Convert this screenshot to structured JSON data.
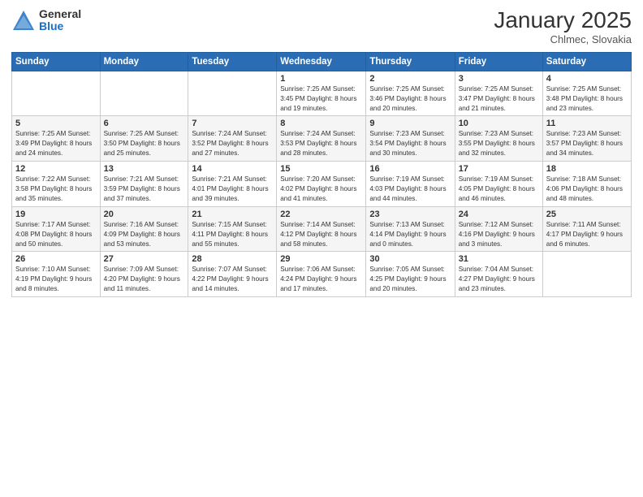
{
  "logo": {
    "general": "General",
    "blue": "Blue"
  },
  "header": {
    "month": "January 2025",
    "location": "Chlmec, Slovakia"
  },
  "weekdays": [
    "Sunday",
    "Monday",
    "Tuesday",
    "Wednesday",
    "Thursday",
    "Friday",
    "Saturday"
  ],
  "weeks": [
    [
      {
        "day": "",
        "info": ""
      },
      {
        "day": "",
        "info": ""
      },
      {
        "day": "",
        "info": ""
      },
      {
        "day": "1",
        "info": "Sunrise: 7:25 AM\nSunset: 3:45 PM\nDaylight: 8 hours\nand 19 minutes."
      },
      {
        "day": "2",
        "info": "Sunrise: 7:25 AM\nSunset: 3:46 PM\nDaylight: 8 hours\nand 20 minutes."
      },
      {
        "day": "3",
        "info": "Sunrise: 7:25 AM\nSunset: 3:47 PM\nDaylight: 8 hours\nand 21 minutes."
      },
      {
        "day": "4",
        "info": "Sunrise: 7:25 AM\nSunset: 3:48 PM\nDaylight: 8 hours\nand 23 minutes."
      }
    ],
    [
      {
        "day": "5",
        "info": "Sunrise: 7:25 AM\nSunset: 3:49 PM\nDaylight: 8 hours\nand 24 minutes."
      },
      {
        "day": "6",
        "info": "Sunrise: 7:25 AM\nSunset: 3:50 PM\nDaylight: 8 hours\nand 25 minutes."
      },
      {
        "day": "7",
        "info": "Sunrise: 7:24 AM\nSunset: 3:52 PM\nDaylight: 8 hours\nand 27 minutes."
      },
      {
        "day": "8",
        "info": "Sunrise: 7:24 AM\nSunset: 3:53 PM\nDaylight: 8 hours\nand 28 minutes."
      },
      {
        "day": "9",
        "info": "Sunrise: 7:23 AM\nSunset: 3:54 PM\nDaylight: 8 hours\nand 30 minutes."
      },
      {
        "day": "10",
        "info": "Sunrise: 7:23 AM\nSunset: 3:55 PM\nDaylight: 8 hours\nand 32 minutes."
      },
      {
        "day": "11",
        "info": "Sunrise: 7:23 AM\nSunset: 3:57 PM\nDaylight: 8 hours\nand 34 minutes."
      }
    ],
    [
      {
        "day": "12",
        "info": "Sunrise: 7:22 AM\nSunset: 3:58 PM\nDaylight: 8 hours\nand 35 minutes."
      },
      {
        "day": "13",
        "info": "Sunrise: 7:21 AM\nSunset: 3:59 PM\nDaylight: 8 hours\nand 37 minutes."
      },
      {
        "day": "14",
        "info": "Sunrise: 7:21 AM\nSunset: 4:01 PM\nDaylight: 8 hours\nand 39 minutes."
      },
      {
        "day": "15",
        "info": "Sunrise: 7:20 AM\nSunset: 4:02 PM\nDaylight: 8 hours\nand 41 minutes."
      },
      {
        "day": "16",
        "info": "Sunrise: 7:19 AM\nSunset: 4:03 PM\nDaylight: 8 hours\nand 44 minutes."
      },
      {
        "day": "17",
        "info": "Sunrise: 7:19 AM\nSunset: 4:05 PM\nDaylight: 8 hours\nand 46 minutes."
      },
      {
        "day": "18",
        "info": "Sunrise: 7:18 AM\nSunset: 4:06 PM\nDaylight: 8 hours\nand 48 minutes."
      }
    ],
    [
      {
        "day": "19",
        "info": "Sunrise: 7:17 AM\nSunset: 4:08 PM\nDaylight: 8 hours\nand 50 minutes."
      },
      {
        "day": "20",
        "info": "Sunrise: 7:16 AM\nSunset: 4:09 PM\nDaylight: 8 hours\nand 53 minutes."
      },
      {
        "day": "21",
        "info": "Sunrise: 7:15 AM\nSunset: 4:11 PM\nDaylight: 8 hours\nand 55 minutes."
      },
      {
        "day": "22",
        "info": "Sunrise: 7:14 AM\nSunset: 4:12 PM\nDaylight: 8 hours\nand 58 minutes."
      },
      {
        "day": "23",
        "info": "Sunrise: 7:13 AM\nSunset: 4:14 PM\nDaylight: 9 hours\nand 0 minutes."
      },
      {
        "day": "24",
        "info": "Sunrise: 7:12 AM\nSunset: 4:16 PM\nDaylight: 9 hours\nand 3 minutes."
      },
      {
        "day": "25",
        "info": "Sunrise: 7:11 AM\nSunset: 4:17 PM\nDaylight: 9 hours\nand 6 minutes."
      }
    ],
    [
      {
        "day": "26",
        "info": "Sunrise: 7:10 AM\nSunset: 4:19 PM\nDaylight: 9 hours\nand 8 minutes."
      },
      {
        "day": "27",
        "info": "Sunrise: 7:09 AM\nSunset: 4:20 PM\nDaylight: 9 hours\nand 11 minutes."
      },
      {
        "day": "28",
        "info": "Sunrise: 7:07 AM\nSunset: 4:22 PM\nDaylight: 9 hours\nand 14 minutes."
      },
      {
        "day": "29",
        "info": "Sunrise: 7:06 AM\nSunset: 4:24 PM\nDaylight: 9 hours\nand 17 minutes."
      },
      {
        "day": "30",
        "info": "Sunrise: 7:05 AM\nSunset: 4:25 PM\nDaylight: 9 hours\nand 20 minutes."
      },
      {
        "day": "31",
        "info": "Sunrise: 7:04 AM\nSunset: 4:27 PM\nDaylight: 9 hours\nand 23 minutes."
      },
      {
        "day": "",
        "info": ""
      }
    ]
  ]
}
